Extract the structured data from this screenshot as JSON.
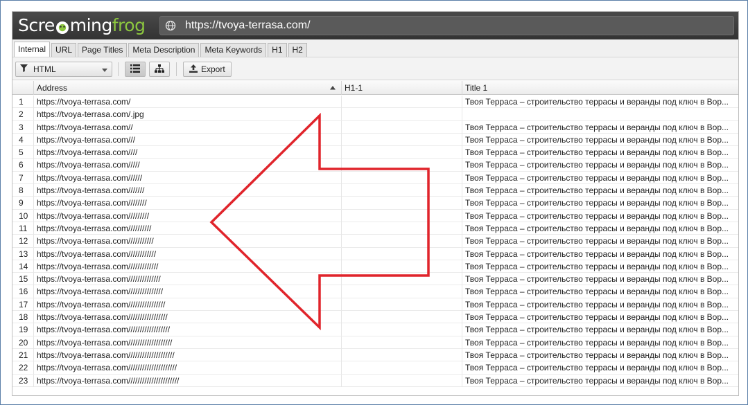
{
  "app": {
    "logo": {
      "part1": "Scre",
      "part2": "ming",
      "part3": "frog"
    },
    "url": "https://tvoya-terrasa.com/"
  },
  "tabs": [
    "Internal",
    "URL",
    "Page Titles",
    "Meta Description",
    "Meta Keywords",
    "H1",
    "H2"
  ],
  "active_tab": "Internal",
  "toolbar": {
    "filter_value": "HTML",
    "export_label": "Export"
  },
  "columns": {
    "address": "Address",
    "h1": "H1-1",
    "title": "Title 1"
  },
  "rows": [
    {
      "n": "1",
      "address": "https://tvoya-terrasa.com/",
      "h1": "",
      "title": "Твоя Терраса – строительство террасы и веранды под ключ в Вор..."
    },
    {
      "n": "2",
      "address": "https://tvoya-terrasa.com/.jpg",
      "h1": "",
      "title": ""
    },
    {
      "n": "3",
      "address": "https://tvoya-terrasa.com//",
      "h1": "",
      "title": "Твоя Терраса – строительство террасы и веранды под ключ в Вор..."
    },
    {
      "n": "4",
      "address": "https://tvoya-terrasa.com///",
      "h1": "",
      "title": "Твоя Терраса – строительство террасы и веранды под ключ в Вор..."
    },
    {
      "n": "5",
      "address": "https://tvoya-terrasa.com////",
      "h1": "",
      "title": "Твоя Терраса – строительство террасы и веранды под ключ в Вор..."
    },
    {
      "n": "6",
      "address": "https://tvoya-terrasa.com/////",
      "h1": "",
      "title": "Твоя Терраса – строительство террасы и веранды под ключ в Вор..."
    },
    {
      "n": "7",
      "address": "https://tvoya-terrasa.com//////",
      "h1": "",
      "title": "Твоя Терраса – строительство террасы и веранды под ключ в Вор..."
    },
    {
      "n": "8",
      "address": "https://tvoya-terrasa.com///////",
      "h1": "",
      "title": "Твоя Терраса – строительство террасы и веранды под ключ в Вор..."
    },
    {
      "n": "9",
      "address": "https://tvoya-terrasa.com////////",
      "h1": "",
      "title": "Твоя Терраса – строительство террасы и веранды под ключ в Вор..."
    },
    {
      "n": "10",
      "address": "https://tvoya-terrasa.com/////////",
      "h1": "",
      "title": "Твоя Терраса – строительство террасы и веранды под ключ в Вор..."
    },
    {
      "n": "11",
      "address": "https://tvoya-terrasa.com//////////",
      "h1": "",
      "title": "Твоя Терраса – строительство террасы и веранды под ключ в Вор..."
    },
    {
      "n": "12",
      "address": "https://tvoya-terrasa.com///////////",
      "h1": "",
      "title": "Твоя Терраса – строительство террасы и веранды под ключ в Вор..."
    },
    {
      "n": "13",
      "address": "https://tvoya-terrasa.com////////////",
      "h1": "",
      "title": "Твоя Терраса – строительство террасы и веранды под ключ в Вор..."
    },
    {
      "n": "14",
      "address": "https://tvoya-terrasa.com/////////////",
      "h1": "",
      "title": "Твоя Терраса – строительство террасы и веранды под ключ в Вор..."
    },
    {
      "n": "15",
      "address": "https://tvoya-terrasa.com//////////////",
      "h1": "",
      "title": "Твоя Терраса – строительство террасы и веранды под ключ в Вор..."
    },
    {
      "n": "16",
      "address": "https://tvoya-terrasa.com///////////////",
      "h1": "",
      "title": "Твоя Терраса – строительство террасы и веранды под ключ в Вор..."
    },
    {
      "n": "17",
      "address": "https://tvoya-terrasa.com////////////////",
      "h1": "",
      "title": "Твоя Терраса – строительство террасы и веранды под ключ в Вор..."
    },
    {
      "n": "18",
      "address": "https://tvoya-terrasa.com/////////////////",
      "h1": "",
      "title": "Твоя Терраса – строительство террасы и веранды под ключ в Вор..."
    },
    {
      "n": "19",
      "address": "https://tvoya-terrasa.com//////////////////",
      "h1": "",
      "title": "Твоя Терраса – строительство террасы и веранды под ключ в Вор..."
    },
    {
      "n": "20",
      "address": "https://tvoya-terrasa.com///////////////////",
      "h1": "",
      "title": "Твоя Терраса – строительство террасы и веранды под ключ в Вор..."
    },
    {
      "n": "21",
      "address": "https://tvoya-terrasa.com////////////////////",
      "h1": "",
      "title": "Твоя Терраса – строительство террасы и веранды под ключ в Вор..."
    },
    {
      "n": "22",
      "address": "https://tvoya-terrasa.com/////////////////////",
      "h1": "",
      "title": "Твоя Терраса – строительство террасы и веранды под ключ в Вор..."
    },
    {
      "n": "23",
      "address": "https://tvoya-terrasa.com//////////////////////",
      "h1": "",
      "title": "Твоя Терраса – строительство террасы и веранды под ключ в Вор..."
    }
  ],
  "colors": {
    "logo_green": "#8cc63f",
    "arrow_red": "#e0242b",
    "frame_blue": "#5b7fa8"
  },
  "icons": [
    "globe-icon",
    "filter-icon",
    "chevron-down-icon",
    "list-view-icon",
    "tree-view-icon",
    "export-icon",
    "sort-up-icon"
  ]
}
